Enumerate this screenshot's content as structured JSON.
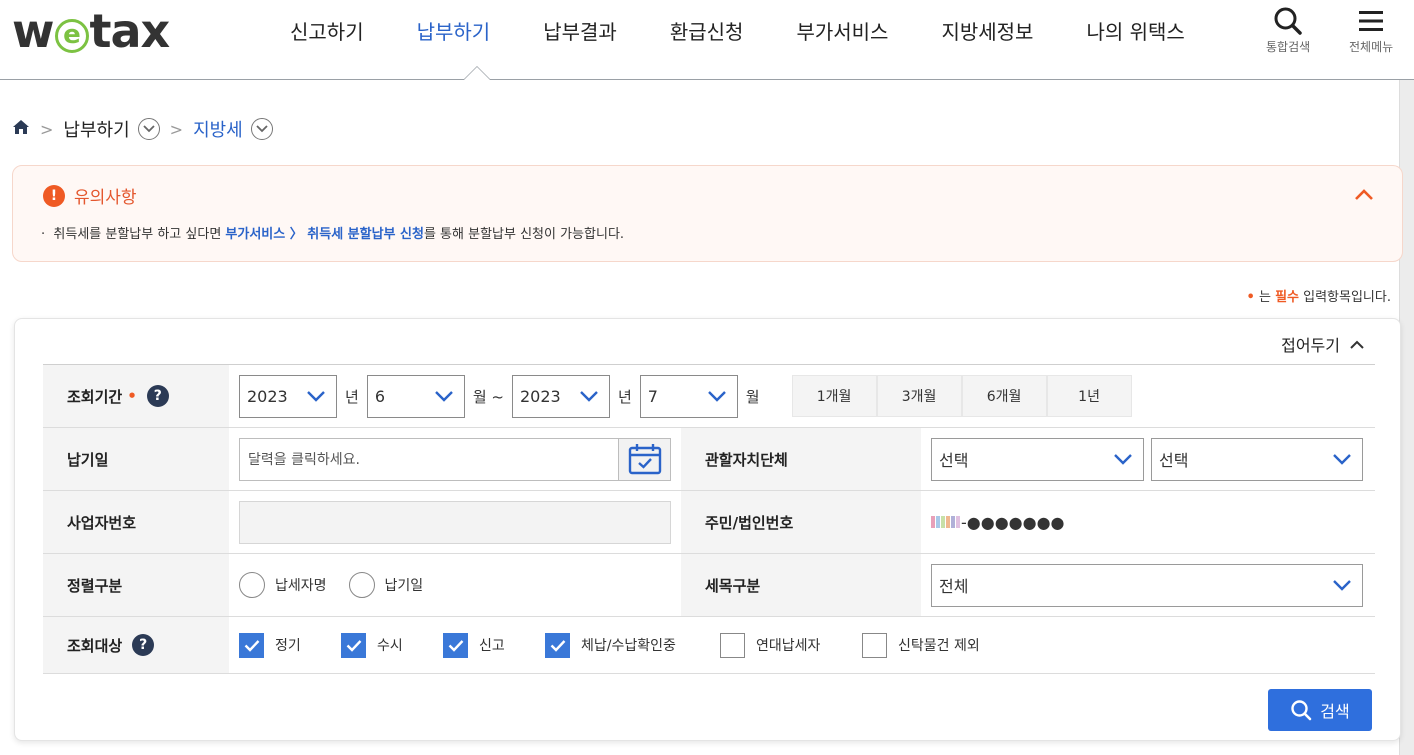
{
  "header": {
    "logo": {
      "prefix": "w",
      "circle": "e",
      "suffix": "tax"
    },
    "nav": [
      {
        "label": "신고하기",
        "active": false
      },
      {
        "label": "납부하기",
        "active": true
      },
      {
        "label": "납부결과",
        "active": false
      },
      {
        "label": "환급신청",
        "active": false
      },
      {
        "label": "부가서비스",
        "active": false
      },
      {
        "label": "지방세정보",
        "active": false
      },
      {
        "label": "나의 위택스",
        "active": false
      }
    ],
    "search_label": "통합검색",
    "menu_label": "전체메뉴"
  },
  "breadcrumb": {
    "home_icon": "home-icon",
    "level1": "납부하기",
    "level2": "지방세"
  },
  "notice": {
    "title": "유의사항",
    "text_before": "취득세를 분할납부 하고 싶다면 ",
    "link_text": "부가서비스 〉 취득세 분할납부 신청",
    "text_after": "를 통해 분할납부 신청이 가능합니다."
  },
  "required_note": {
    "dot": "•",
    "pre": "는 ",
    "emph": "필수",
    "post": " 입력항목입니다."
  },
  "panel": {
    "fold_label": "접어두기",
    "period": {
      "label": "조회기간",
      "required_mark": "•",
      "from_year": "2023",
      "from_month": "6",
      "to_year": "2023",
      "to_month": "7",
      "unit_year": "년",
      "unit_month_range": "월 ~",
      "unit_month": "월",
      "quick_buttons": [
        "1개월",
        "3개월",
        "6개월",
        "1년"
      ]
    },
    "due_date": {
      "label": "납기일",
      "placeholder": "달력을 클릭하세요."
    },
    "jurisdiction": {
      "label": "관할자치단체",
      "select1": "선택",
      "select2": "선택"
    },
    "business_no": {
      "label": "사업자번호",
      "value": ""
    },
    "resident_no": {
      "label": "주민/법인번호",
      "masked_tail": "-●●●●●●●"
    },
    "sort": {
      "label": "정렬구분",
      "options": [
        "납세자명",
        "납기일"
      ]
    },
    "tax_item": {
      "label": "세목구분",
      "value": "전체"
    },
    "target": {
      "label": "조회대상",
      "options": [
        {
          "label": "정기",
          "checked": true
        },
        {
          "label": "수시",
          "checked": true
        },
        {
          "label": "신고",
          "checked": true
        },
        {
          "label": "체납/수납확인중",
          "checked": true
        },
        {
          "label": "연대납세자",
          "checked": false
        },
        {
          "label": "신탁물건 제외",
          "checked": false
        }
      ]
    },
    "search_button": "검색"
  },
  "colors": {
    "accent_blue": "#2a63c9",
    "button_blue": "#2f6fdd",
    "warning_orange": "#ef5a24",
    "notice_bg": "#fff8f5"
  }
}
